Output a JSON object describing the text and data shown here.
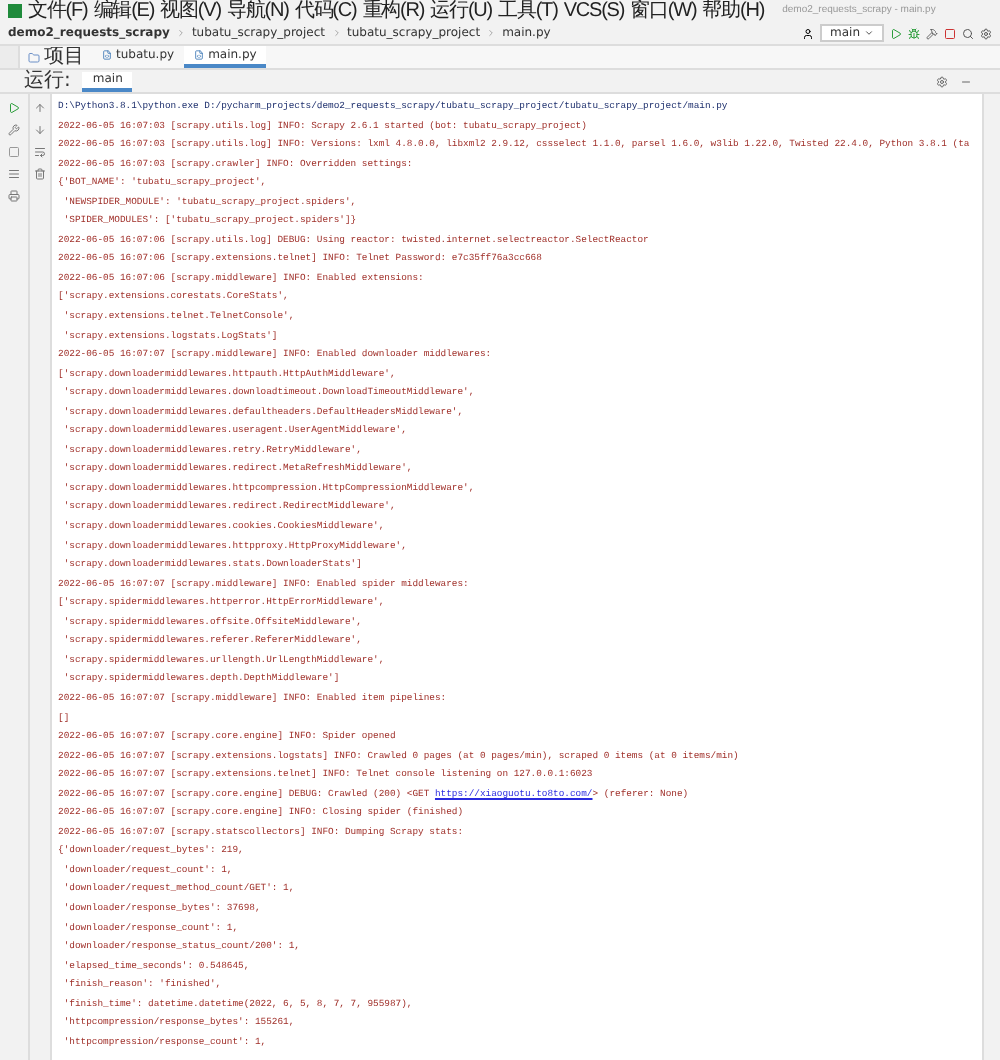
{
  "window": {
    "title": "demo2_requests_scrapy - main.py"
  },
  "menu": [
    "文件(F)",
    "编辑(E)",
    "视图(V)",
    "导航(N)",
    "代码(C)",
    "重构(R)",
    "运行(U)",
    "工具(T)",
    "VCS(S)",
    "窗口(W)",
    "帮助(H)"
  ],
  "breadcrumbs": [
    "demo2_requests_scrapy",
    "tubatu_scrapy_project",
    "tubatu_scrapy_project",
    "main.py"
  ],
  "run_config": "main",
  "project_tool": "项目",
  "editor_tabs": [
    {
      "label": "tubatu.py",
      "selected": false
    },
    {
      "label": "main.py",
      "selected": true
    }
  ],
  "run_panel": {
    "label": "运行:",
    "tab": "main"
  },
  "console": [
    {
      "kind": "command",
      "text": "D:\\Python3.8.1\\python.exe D:/pycharm_projects/demo2_requests_scrapy/tubatu_scrapy_project/tubatu_scrapy_project/main.py"
    },
    {
      "kind": "log",
      "text": "2022-06-05 16:07:03 [scrapy.utils.log] INFO: Scrapy 2.6.1 started (bot: tubatu_scrapy_project)"
    },
    {
      "kind": "log",
      "text": "2022-06-05 16:07:03 [scrapy.utils.log] INFO: Versions: lxml 4.8.0.0, libxml2 2.9.12, cssselect 1.1.0, parsel 1.6.0, w3lib 1.22.0, Twisted 22.4.0, Python 3.8.1 (ta"
    },
    {
      "kind": "log",
      "text": "2022-06-05 16:07:03 [scrapy.crawler] INFO: Overridden settings:"
    },
    {
      "kind": "log",
      "text": "{'BOT_NAME': 'tubatu_scrapy_project',"
    },
    {
      "kind": "log",
      "text": " 'NEWSPIDER_MODULE': 'tubatu_scrapy_project.spiders',"
    },
    {
      "kind": "log",
      "text": " 'SPIDER_MODULES': ['tubatu_scrapy_project.spiders']}"
    },
    {
      "kind": "log",
      "text": "2022-06-05 16:07:06 [scrapy.utils.log] DEBUG: Using reactor: twisted.internet.selectreactor.SelectReactor"
    },
    {
      "kind": "log",
      "text": "2022-06-05 16:07:06 [scrapy.extensions.telnet] INFO: Telnet Password: e7c35ff76a3cc668"
    },
    {
      "kind": "log",
      "text": "2022-06-05 16:07:06 [scrapy.middleware] INFO: Enabled extensions:"
    },
    {
      "kind": "log",
      "text": "['scrapy.extensions.corestats.CoreStats',"
    },
    {
      "kind": "log",
      "text": " 'scrapy.extensions.telnet.TelnetConsole',"
    },
    {
      "kind": "log",
      "text": " 'scrapy.extensions.logstats.LogStats']"
    },
    {
      "kind": "log",
      "text": "2022-06-05 16:07:07 [scrapy.middleware] INFO: Enabled downloader middlewares:"
    },
    {
      "kind": "log",
      "text": "['scrapy.downloadermiddlewares.httpauth.HttpAuthMiddleware',"
    },
    {
      "kind": "log",
      "text": " 'scrapy.downloadermiddlewares.downloadtimeout.DownloadTimeoutMiddleware',"
    },
    {
      "kind": "log",
      "text": " 'scrapy.downloadermiddlewares.defaultheaders.DefaultHeadersMiddleware',"
    },
    {
      "kind": "log",
      "text": " 'scrapy.downloadermiddlewares.useragent.UserAgentMiddleware',"
    },
    {
      "kind": "log",
      "text": " 'scrapy.downloadermiddlewares.retry.RetryMiddleware',"
    },
    {
      "kind": "log",
      "text": " 'scrapy.downloadermiddlewares.redirect.MetaRefreshMiddleware',"
    },
    {
      "kind": "log",
      "text": " 'scrapy.downloadermiddlewares.httpcompression.HttpCompressionMiddleware',"
    },
    {
      "kind": "log",
      "text": " 'scrapy.downloadermiddlewares.redirect.RedirectMiddleware',"
    },
    {
      "kind": "log",
      "text": " 'scrapy.downloadermiddlewares.cookies.CookiesMiddleware',"
    },
    {
      "kind": "log",
      "text": " 'scrapy.downloadermiddlewares.httpproxy.HttpProxyMiddleware',"
    },
    {
      "kind": "log",
      "text": " 'scrapy.downloadermiddlewares.stats.DownloaderStats']"
    },
    {
      "kind": "log",
      "text": "2022-06-05 16:07:07 [scrapy.middleware] INFO: Enabled spider middlewares:"
    },
    {
      "kind": "log",
      "text": "['scrapy.spidermiddlewares.httperror.HttpErrorMiddleware',"
    },
    {
      "kind": "log",
      "text": " 'scrapy.spidermiddlewares.offsite.OffsiteMiddleware',"
    },
    {
      "kind": "log",
      "text": " 'scrapy.spidermiddlewares.referer.RefererMiddleware',"
    },
    {
      "kind": "log",
      "text": " 'scrapy.spidermiddlewares.urllength.UrlLengthMiddleware',"
    },
    {
      "kind": "log",
      "text": " 'scrapy.spidermiddlewares.depth.DepthMiddleware']"
    },
    {
      "kind": "log",
      "text": "2022-06-05 16:07:07 [scrapy.middleware] INFO: Enabled item pipelines:"
    },
    {
      "kind": "log",
      "text": "[]"
    },
    {
      "kind": "log",
      "text": "2022-06-05 16:07:07 [scrapy.core.engine] INFO: Spider opened"
    },
    {
      "kind": "log",
      "text": "2022-06-05 16:07:07 [scrapy.extensions.logstats] INFO: Crawled 0 pages (at 0 pages/min), scraped 0 items (at 0 items/min)"
    },
    {
      "kind": "log",
      "text": "2022-06-05 16:07:07 [scrapy.extensions.telnet] INFO: Telnet console listening on 127.0.0.1:6023"
    },
    {
      "kind": "link",
      "text": "2022-06-05 16:07:07 [scrapy.core.engine] DEBUG: Crawled (200) <GET",
      "link": "https://xiaoguotu.to8to.com/",
      "after": "> (referer: None)"
    },
    {
      "kind": "log",
      "text": "2022-06-05 16:07:07 [scrapy.core.engine] INFO: Closing spider (finished)"
    },
    {
      "kind": "log",
      "text": "2022-06-05 16:07:07 [scrapy.statscollectors] INFO: Dumping Scrapy stats:"
    },
    {
      "kind": "log",
      "text": "{'downloader/request_bytes': 219,"
    },
    {
      "kind": "log",
      "text": " 'downloader/request_count': 1,"
    },
    {
      "kind": "log",
      "text": " 'downloader/request_method_count/GET': 1,"
    },
    {
      "kind": "log",
      "text": " 'downloader/response_bytes': 37698,"
    },
    {
      "kind": "log",
      "text": " 'downloader/response_count': 1,"
    },
    {
      "kind": "log",
      "text": " 'downloader/response_status_count/200': 1,"
    },
    {
      "kind": "log",
      "text": " 'elapsed_time_seconds': 0.548645,"
    },
    {
      "kind": "log",
      "text": " 'finish_reason': 'finished',"
    },
    {
      "kind": "log",
      "text": " 'finish_time': datetime.datetime(2022, 6, 5, 8, 7, 7, 955987),"
    },
    {
      "kind": "log",
      "text": " 'httpcompression/response_bytes': 155261,"
    },
    {
      "kind": "log",
      "text": " 'httpcompression/response_count': 1,"
    }
  ]
}
